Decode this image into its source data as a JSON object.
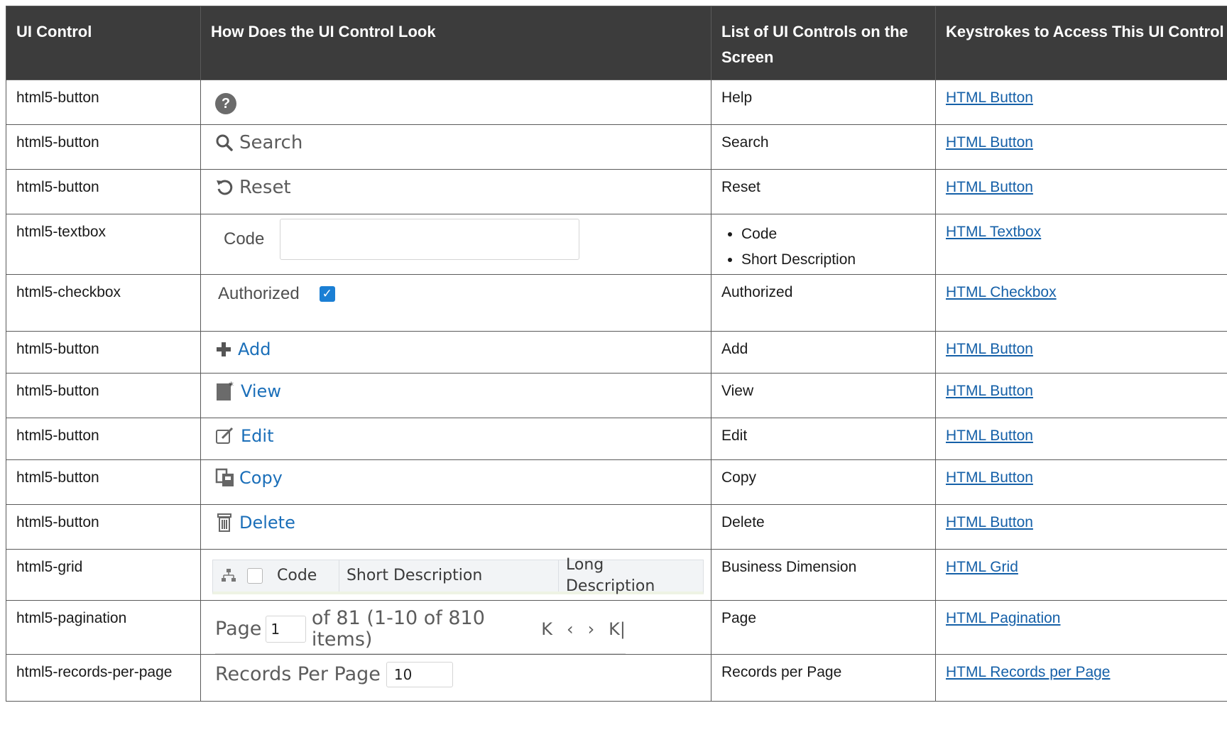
{
  "headers": [
    "UI Control",
    "How Does the UI Control Look",
    "List of UI Controls on the Screen",
    "Keystrokes to Access This UI Control"
  ],
  "rows": [
    {
      "ui_control": "html5-button",
      "controls": "Help",
      "link": "HTML Button",
      "icon": "help-circle-icon"
    },
    {
      "ui_control": "html5-button",
      "look_label": "Search",
      "controls": "Search",
      "link": "HTML Button",
      "icon": "search-icon"
    },
    {
      "ui_control": "html5-button",
      "look_label": "Reset",
      "controls": "Reset",
      "link": "HTML Button",
      "icon": "reset-icon"
    },
    {
      "ui_control": "html5-textbox",
      "look_label": "Code",
      "controls_list": [
        "Code",
        "Short Description"
      ],
      "link": "HTML Textbox"
    },
    {
      "ui_control": "html5-checkbox",
      "look_label": "Authorized",
      "controls": "Authorized",
      "link": "HTML Checkbox",
      "checked": true
    },
    {
      "ui_control": "html5-button",
      "look_label": "Add",
      "controls": "Add",
      "link": "HTML Button",
      "icon": "plus-icon"
    },
    {
      "ui_control": "html5-button",
      "look_label": "View",
      "controls": "View",
      "link": "HTML Button",
      "icon": "view-icon"
    },
    {
      "ui_control": "html5-button",
      "look_label": "Edit",
      "controls": "Edit",
      "link": "HTML Button",
      "icon": "edit-icon"
    },
    {
      "ui_control": "html5-button",
      "look_label": "Copy",
      "controls": "Copy",
      "link": "HTML Button",
      "icon": "copy-icon"
    },
    {
      "ui_control": "html5-button",
      "look_label": "Delete",
      "controls": "Delete",
      "link": "HTML Button",
      "icon": "trash-icon"
    },
    {
      "ui_control": "html5-grid",
      "grid_columns": [
        "Code",
        "Short Description",
        "Long Description"
      ],
      "controls": "Business Dimension",
      "link": "HTML Grid"
    },
    {
      "ui_control": "html5-pagination",
      "page_label": "Page",
      "page_value": "1",
      "page_info": "of 81 (1-10 of 810 items)",
      "nav_icons": [
        "K",
        "‹",
        "›",
        "K|"
      ],
      "controls": "Page",
      "link": "HTML Pagination"
    },
    {
      "ui_control": "html5-records-per-page",
      "look_label": "Records Per Page",
      "rpp_value": "10",
      "controls": "Records per Page",
      "link": "HTML Records per Page"
    }
  ]
}
